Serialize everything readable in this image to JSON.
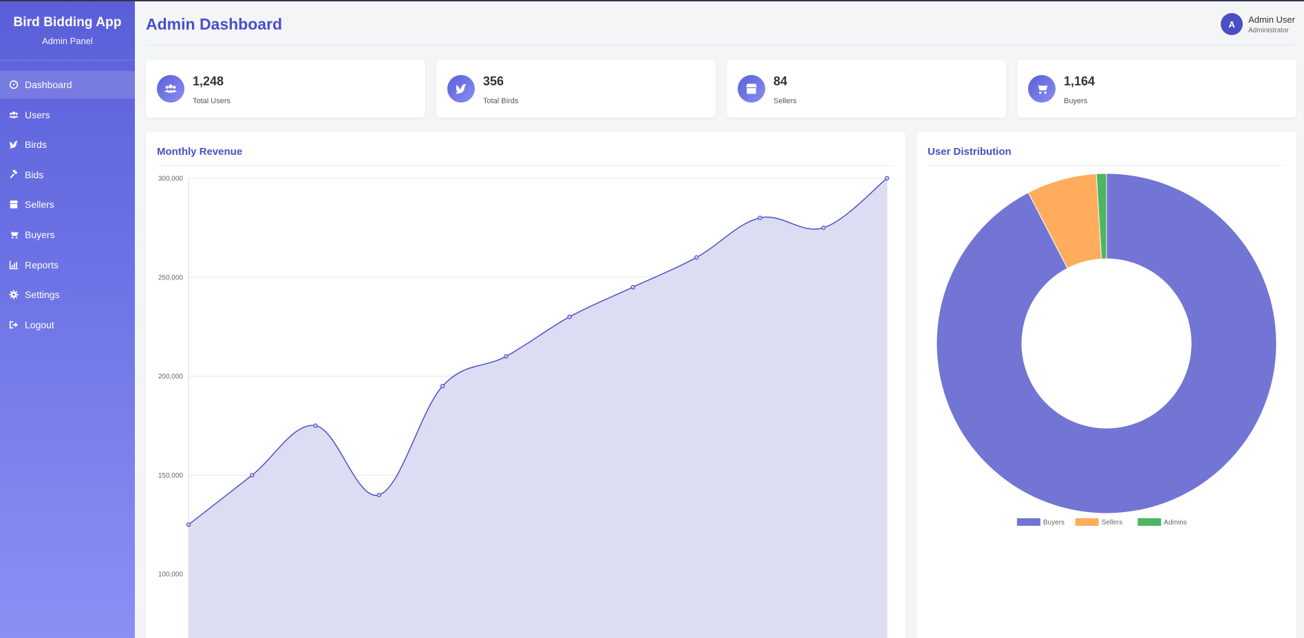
{
  "sidebar": {
    "title": "Bird Bidding App",
    "subtitle": "Admin Panel",
    "items": [
      {
        "label": "Dashboard",
        "icon": "gauge-icon",
        "active": true
      },
      {
        "label": "Users",
        "icon": "users-icon"
      },
      {
        "label": "Birds",
        "icon": "dove-icon"
      },
      {
        "label": "Bids",
        "icon": "gavel-icon"
      },
      {
        "label": "Sellers",
        "icon": "store-icon"
      },
      {
        "label": "Buyers",
        "icon": "cart-icon"
      },
      {
        "label": "Reports",
        "icon": "chart-icon"
      },
      {
        "label": "Settings",
        "icon": "gear-icon"
      },
      {
        "label": "Logout",
        "icon": "logout-icon"
      }
    ]
  },
  "header": {
    "title": "Admin Dashboard",
    "user": {
      "initial": "A",
      "name": "Admin User",
      "role": "Administrator"
    }
  },
  "stats": [
    {
      "value": "1,248",
      "label": "Total Users",
      "icon": "users-icon"
    },
    {
      "value": "356",
      "label": "Total Birds",
      "icon": "dove-icon"
    },
    {
      "value": "84",
      "label": "Sellers",
      "icon": "store-icon"
    },
    {
      "value": "1,164",
      "label": "Buyers",
      "icon": "cart-icon"
    }
  ],
  "colors": {
    "accent": "#4a4fc7",
    "line": "#4b50c8",
    "area_fill": "#dcdcf3",
    "buyers": "#7275d3",
    "sellers": "#ffad5c",
    "admins": "#4cb662"
  },
  "revenue_panel": {
    "title": "Monthly Revenue"
  },
  "distribution_panel": {
    "title": "User Distribution"
  },
  "chart_data": [
    {
      "type": "area",
      "title": "Monthly Revenue",
      "xlabel": "",
      "ylabel": "",
      "ylim": [
        100000,
        300000
      ],
      "yticks": [
        "300,000",
        "250,000",
        "200,000",
        "150,000",
        "100,000"
      ],
      "grid": true,
      "series": [
        {
          "values": [
            125000,
            150000,
            175000,
            140000,
            195000,
            210000,
            230000,
            245000,
            260000,
            280000,
            275000,
            300000
          ]
        }
      ]
    },
    {
      "type": "pie",
      "variant": "doughnut",
      "title": "User Distribution",
      "legend": "bottom",
      "categories": [
        "Buyers",
        "Sellers",
        "Admins"
      ],
      "values": [
        1164,
        84,
        12
      ]
    }
  ]
}
